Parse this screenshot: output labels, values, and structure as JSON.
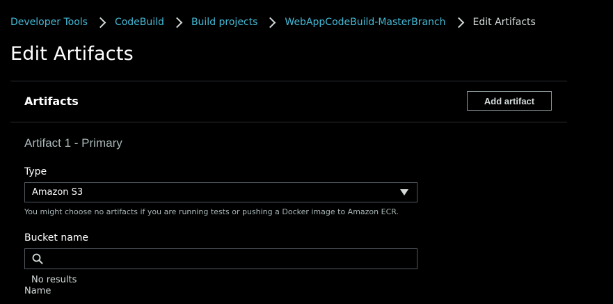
{
  "breadcrumb": {
    "items": [
      "Developer Tools",
      "CodeBuild",
      "Build projects",
      "WebAppCodeBuild-MasterBranch"
    ],
    "current": "Edit Artifacts"
  },
  "page": {
    "title": "Edit Artifacts"
  },
  "panel": {
    "title": "Artifacts",
    "add_button_label": "Add artifact",
    "artifact_heading": "Artifact 1 - Primary",
    "type": {
      "label": "Type",
      "selected": "Amazon S3",
      "hint": "You might choose no artifacts if you are running tests or pushing a Docker image to Amazon ECR."
    },
    "bucket": {
      "label": "Bucket name",
      "value": "",
      "dropdown_message": "No results"
    },
    "next_field_label_partial": "Name"
  },
  "icons": {
    "search": "search-icon",
    "caret": "caret-down-icon",
    "separator": "chevron-right-icon"
  },
  "colors": {
    "link": "#44b9d6",
    "background": "#000000",
    "border": "#545b64"
  }
}
